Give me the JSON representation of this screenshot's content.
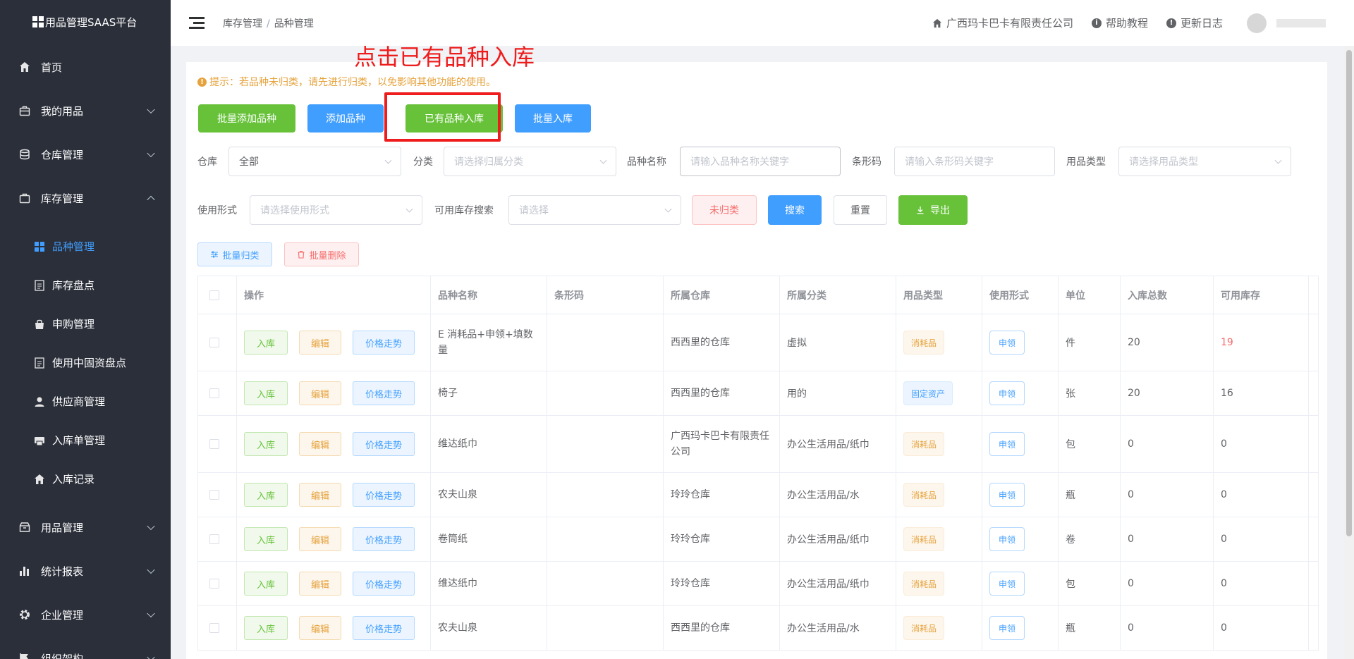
{
  "sidebar": {
    "brand": "用品管理SAAS平台",
    "items": [
      {
        "label": "首页",
        "icon": "home-icon"
      },
      {
        "label": "我的用品",
        "icon": "briefcase-icon"
      },
      {
        "label": "仓库管理",
        "icon": "database-icon"
      },
      {
        "label": "库存管理",
        "icon": "briefcase-icon"
      }
    ],
    "sub_items": [
      {
        "label": "品种管理",
        "icon": "grid-icon"
      },
      {
        "label": "库存盘点",
        "icon": "document-icon"
      },
      {
        "label": "申购管理",
        "icon": "bag-icon"
      },
      {
        "label": "使用中固资盘点",
        "icon": "document-icon"
      },
      {
        "label": "供应商管理",
        "icon": "user-icon"
      },
      {
        "label": "入库单管理",
        "icon": "printer-icon"
      },
      {
        "label": "入库记录",
        "icon": "home-icon"
      }
    ],
    "bottom_items": [
      {
        "label": "用品管理",
        "icon": "box-icon"
      },
      {
        "label": "统计报表",
        "icon": "bar-chart-icon"
      },
      {
        "label": "企业管理",
        "icon": "gear-icon"
      },
      {
        "label": "组织架构",
        "icon": "flag-icon"
      }
    ]
  },
  "header": {
    "breadcrumb_1": "库存管理",
    "breadcrumb_sep": "/",
    "breadcrumb_2": "品种管理",
    "company": "广西玛卡巴卡有限责任公司",
    "help": "帮助教程",
    "changelog": "更新日志"
  },
  "tip": "提示：若品种未归类，请先进行归类，以免影响其他功能的使用。",
  "annotation": "点击已有品种入库",
  "top_buttons": {
    "batch_add": "批量添加品种",
    "add": "添加品种",
    "existing_in": "已有品种入库",
    "batch_in": "批量入库"
  },
  "filters": {
    "warehouse_label": "仓库",
    "warehouse_value": "全部",
    "category_label": "分类",
    "category_placeholder": "请选择归属分类",
    "name_label": "品种名称",
    "name_placeholder": "请输入品种名称关键字",
    "barcode_label": "条形码",
    "barcode_placeholder": "请输入条形码关键字",
    "type_label": "用品类型",
    "type_placeholder": "请选择用品类型",
    "usage_label": "使用形式",
    "usage_placeholder": "请选择使用形式",
    "stock_label": "可用库存搜索",
    "stock_placeholder": "请选择",
    "unclassified": "未归类",
    "search": "搜索",
    "reset": "重置",
    "export": "导出"
  },
  "batch": {
    "classify": "批量归类",
    "delete": "批量删除"
  },
  "table": {
    "headers": [
      "操作",
      "品种名称",
      "条形码",
      "所属仓库",
      "所属分类",
      "用品类型",
      "使用形式",
      "单位",
      "入库总数",
      "可用库存"
    ],
    "op_labels": {
      "in": "入库",
      "edit": "编辑",
      "trend": "价格走势"
    },
    "rows": [
      {
        "name": "E 消耗品+申领+填数量",
        "barcode": "",
        "warehouse": "西西里的仓库",
        "category": "虚拟",
        "type": "消耗品",
        "type_kind": "cons",
        "usage": "申领",
        "unit": "件",
        "total": "20",
        "available": "19",
        "available_red": true
      },
      {
        "name": "椅子",
        "barcode": "",
        "warehouse": "西西里的仓库",
        "category": "用的",
        "type": "固定资产",
        "type_kind": "fixed",
        "usage": "申领",
        "unit": "张",
        "total": "20",
        "available": "16",
        "available_red": false
      },
      {
        "name": "维达纸巾",
        "barcode": "",
        "warehouse": "广西玛卡巴卡有限责任公司",
        "category": "办公生活用品/纸巾",
        "type": "消耗品",
        "type_kind": "cons",
        "usage": "申领",
        "unit": "包",
        "total": "0",
        "available": "0",
        "available_red": false
      },
      {
        "name": "农夫山泉",
        "barcode": "",
        "warehouse": "玲玲仓库",
        "category": "办公生活用品/水",
        "type": "消耗品",
        "type_kind": "cons",
        "usage": "申领",
        "unit": "瓶",
        "total": "0",
        "available": "0",
        "available_red": false
      },
      {
        "name": "卷筒纸",
        "barcode": "",
        "warehouse": "玲玲仓库",
        "category": "办公生活用品/纸巾",
        "type": "消耗品",
        "type_kind": "cons",
        "usage": "申领",
        "unit": "卷",
        "total": "0",
        "available": "0",
        "available_red": false
      },
      {
        "name": "维达纸巾",
        "barcode": "",
        "warehouse": "玲玲仓库",
        "category": "办公生活用品/纸巾",
        "type": "消耗品",
        "type_kind": "cons",
        "usage": "申领",
        "unit": "包",
        "total": "0",
        "available": "0",
        "available_red": false
      },
      {
        "name": "农夫山泉",
        "barcode": "",
        "warehouse": "西西里的仓库",
        "category": "办公生活用品/水",
        "type": "消耗品",
        "type_kind": "cons",
        "usage": "申领",
        "unit": "瓶",
        "total": "0",
        "available": "0",
        "available_red": false
      }
    ]
  }
}
